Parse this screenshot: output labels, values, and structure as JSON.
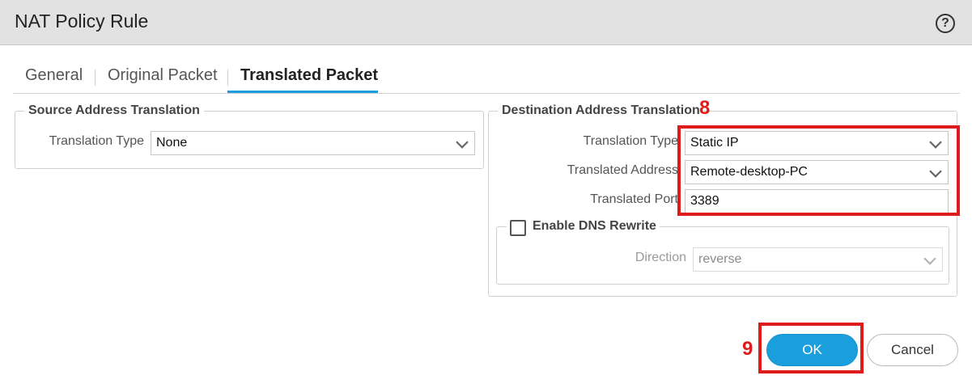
{
  "dialog": {
    "title": "NAT Policy Rule",
    "help_glyph": "?"
  },
  "tabs": [
    {
      "label": "General"
    },
    {
      "label": "Original Packet"
    },
    {
      "label": "Translated Packet",
      "active": true
    }
  ],
  "source": {
    "legend": "Source Address Translation",
    "translation_type_label": "Translation Type",
    "translation_type_value": "None"
  },
  "destination": {
    "legend": "Destination Address Translation",
    "translation_type_label": "Translation Type",
    "translation_type_value": "Static IP",
    "translated_address_label": "Translated Address",
    "translated_address_value": "Remote-desktop-PC",
    "translated_port_label": "Translated Port",
    "translated_port_value": "3389",
    "dns_rewrite": {
      "label": "Enable DNS Rewrite",
      "checked": false,
      "direction_label": "Direction",
      "direction_value": "reverse"
    }
  },
  "annotations": {
    "step8": "8",
    "step9": "9"
  },
  "buttons": {
    "ok": "OK",
    "cancel": "Cancel"
  },
  "colors": {
    "accent": "#1b9fdc",
    "highlight": "#e01b1b"
  }
}
